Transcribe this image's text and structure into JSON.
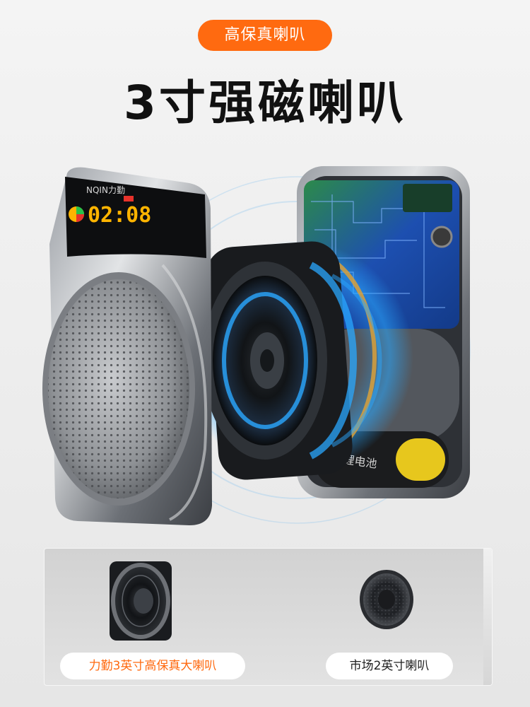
{
  "header": {
    "badge": "高保真喇叭",
    "title": "3寸强磁喇叭"
  },
  "device": {
    "brand": "NQIN力勤",
    "time": "02:08",
    "battery_label": "锂电池"
  },
  "comparison": {
    "ours_label": "力勤3英寸高保真大喇叭",
    "market_label": "市场2英寸喇叭"
  },
  "colors": {
    "accent": "#ff6a10",
    "display_digits": "#ffb400",
    "glow": "#2aa8ff"
  }
}
